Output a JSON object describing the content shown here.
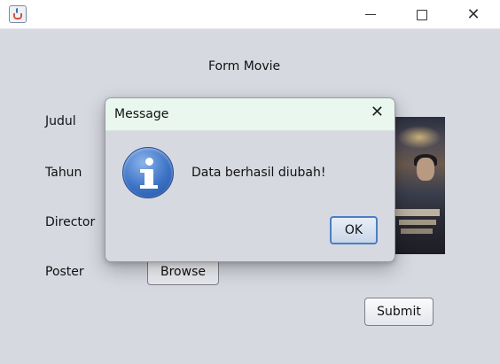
{
  "window": {
    "title": "",
    "controls": {
      "minimize_icon": "minimize-icon",
      "maximize_icon": "maximize-icon",
      "close_icon": "close-icon",
      "close_glyph": "✕"
    }
  },
  "form": {
    "title": "Form Movie",
    "labels": {
      "judul": "Judul",
      "tahun": "Tahun",
      "director": "Director",
      "poster": "Poster"
    },
    "browse_label": "Browse",
    "submit_label": "Submit"
  },
  "dialog": {
    "title": "Message",
    "close_glyph": "✕",
    "icon": "info-icon",
    "message": "Data berhasil diubah!",
    "ok_label": "OK"
  },
  "colors": {
    "background": "#d7d9e1",
    "dialog_titlebar": "#e9f7ef",
    "ok_border": "#4a7fc4"
  }
}
